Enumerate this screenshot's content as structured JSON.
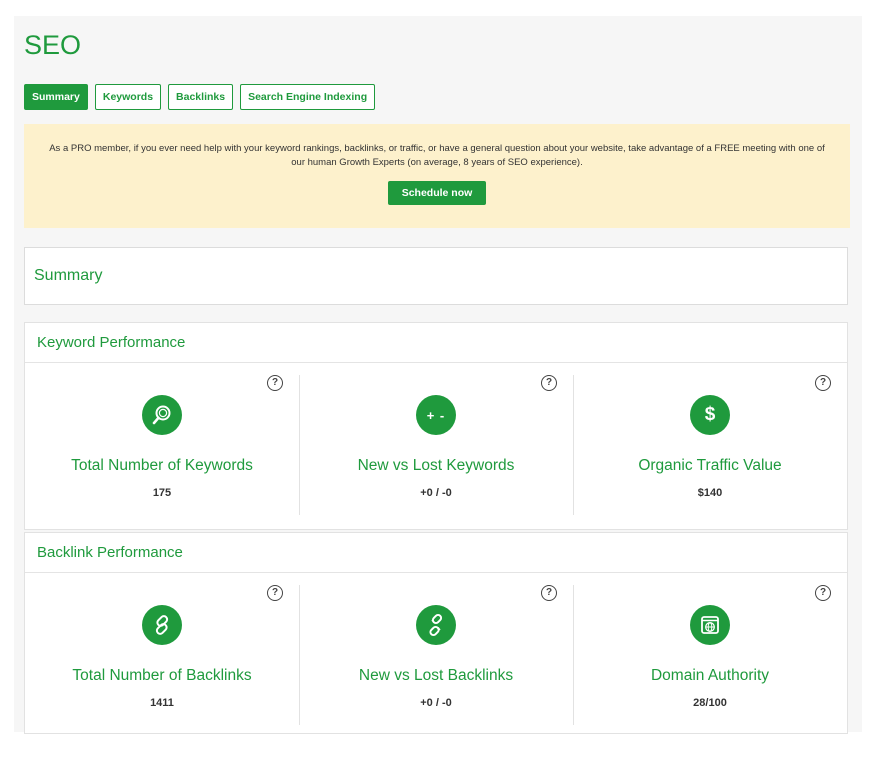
{
  "page": {
    "title": "SEO"
  },
  "tabs": [
    {
      "label": "Summary",
      "active": true
    },
    {
      "label": "Keywords",
      "active": false
    },
    {
      "label": "Backlinks",
      "active": false
    },
    {
      "label": "Search Engine Indexing",
      "active": false
    }
  ],
  "promo": {
    "text": "As a PRO member, if you ever need help with your keyword rankings, backlinks, or traffic, or have a general question about your website, take advantage of a FREE meeting with one of our human Growth Experts (on average, 8 years of SEO experience).",
    "button_label": "Schedule now"
  },
  "summary": {
    "title": "Summary"
  },
  "keyword_performance": {
    "title": "Keyword Performance",
    "metrics": [
      {
        "label": "Total Number of Keywords",
        "value": "175",
        "icon": "magnifier-icon"
      },
      {
        "label": "New vs Lost Keywords",
        "value": "+0 / -0",
        "icon": "plus-minus-icon",
        "icon_text": "+ -"
      },
      {
        "label": "Organic Traffic Value",
        "value": "$140",
        "icon": "dollar-icon",
        "icon_text": "$"
      }
    ]
  },
  "backlink_performance": {
    "title": "Backlink Performance",
    "metrics": [
      {
        "label": "Total Number of Backlinks",
        "value": "1411",
        "icon": "link-icon"
      },
      {
        "label": "New vs Lost Backlinks",
        "value": "+0 / -0",
        "icon": "broken-link-icon"
      },
      {
        "label": "Domain Authority",
        "value": "28/100",
        "icon": "globe-window-icon"
      }
    ]
  },
  "help_glyph": "?",
  "colors": {
    "accent": "#1f9a3d",
    "promo_bg": "#fdf1cc",
    "panel_bg": "#f6f6f6"
  }
}
